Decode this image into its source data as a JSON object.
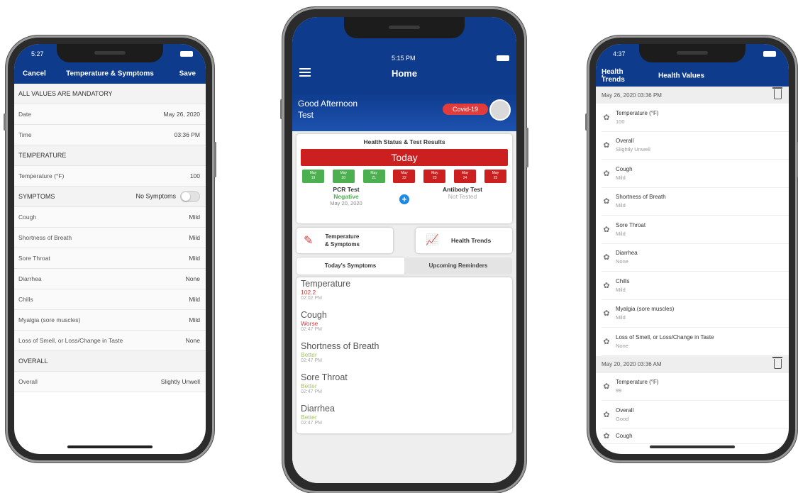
{
  "left": {
    "status_time": "5:27",
    "nav": {
      "cancel": "Cancel",
      "title": "Temperature & Symptoms",
      "save": "Save"
    },
    "mandatory": "ALL VALUES ARE MANDATORY",
    "date_label": "Date",
    "date_value": "May 26, 2020",
    "time_label": "Time",
    "time_value": "03:36 PM",
    "temp_section": "TEMPERATURE",
    "temp_label": "Temperature (°F)",
    "temp_value": "100",
    "symptoms_section": "SYMPTOMS",
    "no_symptoms": "No Symptoms",
    "rows": [
      {
        "label": "Cough",
        "value": "Mild"
      },
      {
        "label": "Shortness of Breath",
        "value": "Mild"
      },
      {
        "label": "Sore Throat",
        "value": "Mild"
      },
      {
        "label": "Diarrhea",
        "value": "None"
      },
      {
        "label": "Chills",
        "value": "Mild"
      },
      {
        "label": "Myalgia (sore muscles)",
        "value": "Mild"
      },
      {
        "label": "Loss of Smell, or Loss/Change in Taste",
        "value": "None"
      }
    ],
    "overall_section": "OVERALL",
    "overall_label": "Overall",
    "overall_value": "Slightly Unwell"
  },
  "middle": {
    "status_time": "5:15 PM",
    "title": "Home",
    "greeting": "Good Afternoon",
    "user": "Test",
    "badge": "Covid-19",
    "card_title": "Health Status & Test Results",
    "today": "Today",
    "dates": [
      {
        "m": "May",
        "d": "19",
        "color": "#4caf50"
      },
      {
        "m": "May",
        "d": "20",
        "color": "#4caf50"
      },
      {
        "m": "May",
        "d": "21",
        "color": "#4caf50"
      },
      {
        "m": "May",
        "d": "22",
        "color": "#cc1f1f"
      },
      {
        "m": "May",
        "d": "23",
        "color": "#cc1f1f"
      },
      {
        "m": "May",
        "d": "24",
        "color": "#cc1f1f"
      },
      {
        "m": "May",
        "d": "25",
        "color": "#cc1f1f"
      }
    ],
    "pcr_label": "PCR Test",
    "pcr_result": "Negative",
    "pcr_date": "May 20, 2020",
    "antibody_label": "Antibody Test",
    "antibody_result": "Not Tested",
    "btn_temp_line1": "Temperature",
    "btn_temp_line2": "& Symptoms",
    "btn_trends": "Health Trends",
    "tab_symptoms": "Today's Symptoms",
    "tab_reminders": "Upcoming Reminders",
    "symptoms": [
      {
        "name": "Temperature",
        "value": "102.2",
        "time": "02:02 PM",
        "color": "#d33a3a"
      },
      {
        "name": "Cough",
        "value": "Worse",
        "time": "02:47 PM",
        "color": "#d33a3a"
      },
      {
        "name": "Shortness of Breath",
        "value": "Better",
        "time": "02:47 PM",
        "color": "#a7c56a"
      },
      {
        "name": "Sore Throat",
        "value": "Better",
        "time": "02:47 PM",
        "color": "#a7c56a"
      },
      {
        "name": "Diarrhea",
        "value": "Better",
        "time": "02:47 PM",
        "color": "#a7c56a"
      }
    ],
    "colors": {
      "primary": "#0e3b8c",
      "danger": "#cc1f1f",
      "ok": "#4caf50"
    }
  },
  "right": {
    "status_time": "4:37",
    "back_label": "Health Trends",
    "title": "Health Values",
    "group1_date": "May 26, 2020  03:36 PM",
    "group1": [
      {
        "t": "Temperature (°F)",
        "v": "100"
      },
      {
        "t": "Overall",
        "v": "Slightly Unwell"
      },
      {
        "t": "Cough",
        "v": "Mild"
      },
      {
        "t": "Shortness of Breath",
        "v": "Mild"
      },
      {
        "t": "Sore Throat",
        "v": "Mild"
      },
      {
        "t": "Diarrhea",
        "v": "None"
      },
      {
        "t": "Chills",
        "v": "Mild"
      },
      {
        "t": "Myalgia (sore muscles)",
        "v": "Mild"
      },
      {
        "t": "Loss of Smell, or Loss/Change in Taste",
        "v": "None"
      }
    ],
    "group2_date": "May 20, 2020  03:36 AM",
    "group2": [
      {
        "t": "Temperature (°F)",
        "v": "99"
      },
      {
        "t": "Overall",
        "v": "Good"
      },
      {
        "t": "Cough",
        "v": ""
      }
    ]
  }
}
